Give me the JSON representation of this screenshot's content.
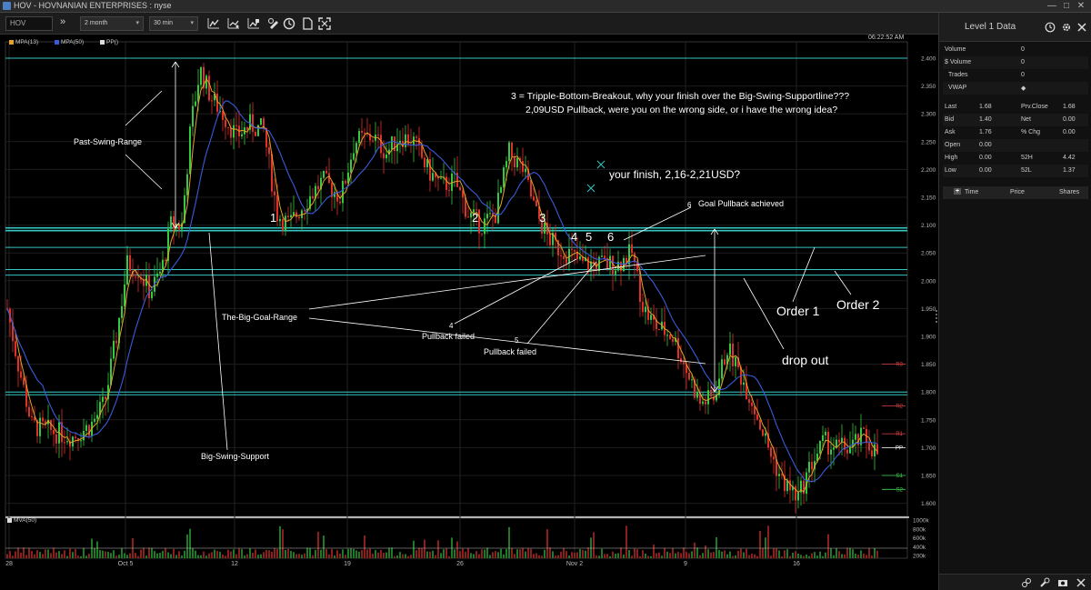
{
  "window": {
    "title": "HOV - HOVNANIAN ENTERPRISES : nyse",
    "min_glyph": "—",
    "max_glyph": "□",
    "close_glyph": "✕"
  },
  "toolbar": {
    "symbol_placeholder": "HOV",
    "forward_glyph": "»",
    "range_value": "2 month",
    "interval_value": "30 min",
    "caret_glyph": "▾",
    "icons": [
      "line-chart-icon",
      "indicator-chart-icon",
      "chart-settings-icon",
      "clock-icon",
      "document-icon",
      "layers-icon",
      "fullscreen-icon"
    ]
  },
  "chart": {
    "timestamp": "06:22:52 AM",
    "legend": [
      {
        "label": "MPA(13)",
        "color": "#e2a32a"
      },
      {
        "label": "MPA(50)",
        "color": "#3a5bd9"
      },
      {
        "label": "PP()",
        "color": "#dddddd"
      }
    ],
    "volume_legend": "MVA(50)",
    "price_axis": [
      "2.400",
      "2.350",
      "2.300",
      "2.250",
      "2.200",
      "2.150",
      "2.100",
      "2.050",
      "2.000",
      "1.950",
      "1.900",
      "1.850",
      "1.800",
      "1.750",
      "1.700",
      "1.650",
      "1.600"
    ],
    "volume_axis": [
      "1000k",
      "800k",
      "600k",
      "400k",
      "200k"
    ],
    "date_axis": [
      {
        "label": "28"
      },
      {
        "label": "Oct 5"
      },
      {
        "label": "12"
      },
      {
        "label": "19"
      },
      {
        "label": "26"
      },
      {
        "label": "Nov 2"
      },
      {
        "label": "9"
      },
      {
        "label": "16"
      }
    ],
    "pivot_labels": [
      {
        "label": "R3",
        "color": "#e04040"
      },
      {
        "label": "R2",
        "color": "#e04040"
      },
      {
        "label": "R1",
        "color": "#e04040"
      },
      {
        "label": "PP",
        "color": "#ffffff"
      },
      {
        "label": "S1",
        "color": "#3fd34f"
      },
      {
        "label": "S2",
        "color": "#3fd34f"
      }
    ],
    "annotations": {
      "question_line1": "3 = Tripple-Bottom-Breakout, why your finish over the Big-Swing-Supportline???",
      "question_line2": "2,09USD Pullback, were you on the wrong side, or i have the wrong idea?",
      "your_finish": "your finish, 2,16-2,21USD?",
      "goal_pullback": "Goal Pullback achieved",
      "goal_pullback_num": "6",
      "past_swing_range": "Past-Swing-Range",
      "big_goal_range": "The-Big-Goal-Range",
      "big_swing_support": "Big-Swing-Support",
      "pullback_failed_4_num": "4",
      "pullback_failed_4": "Pullback failed",
      "pullback_failed_5_num": "5",
      "pullback_failed_5": "Pullback failed",
      "order1": "Order 1",
      "order2": "Order 2",
      "drop_out": "drop out",
      "num1": "1",
      "num2": "2",
      "num3": "3",
      "num4": "4",
      "num5": "5",
      "num6": "6"
    },
    "colors": {
      "up": "#35c93f",
      "down": "#e0302a",
      "ma13": "#e2a32a",
      "ma50": "#3a5bd9",
      "cyan": "#33c6c2"
    }
  },
  "panel": {
    "title": "Level 1 Data",
    "rows": [
      {
        "label": "Volume",
        "value": "0"
      },
      {
        "label": "$ Volume",
        "value": "0"
      },
      {
        "label": "Trades",
        "value": "0"
      },
      {
        "label": "VWAP",
        "value": "◆"
      }
    ],
    "quote_rows": [
      {
        "l1": "Last",
        "v1": "1.68",
        "l2": "Prv.Close",
        "v2": "1.68"
      },
      {
        "l1": "Bid",
        "v1": "1.40",
        "l2": "Net",
        "v2": "0.00"
      },
      {
        "l1": "Ask",
        "v1": "1.76",
        "l2": "% Chg",
        "v2": "0.00"
      },
      {
        "l1": "Open",
        "v1": "0.00",
        "l2": "",
        "v2": ""
      },
      {
        "l1": "High",
        "v1": "0.00",
        "l2": "52H",
        "v2": "4.42"
      },
      {
        "l1": "Low",
        "v1": "0.00",
        "l2": "52L",
        "v2": "1.37"
      }
    ],
    "ts_columns": {
      "time": "Time",
      "price": "Price",
      "shares": "Shares",
      "plus": "+"
    }
  }
}
